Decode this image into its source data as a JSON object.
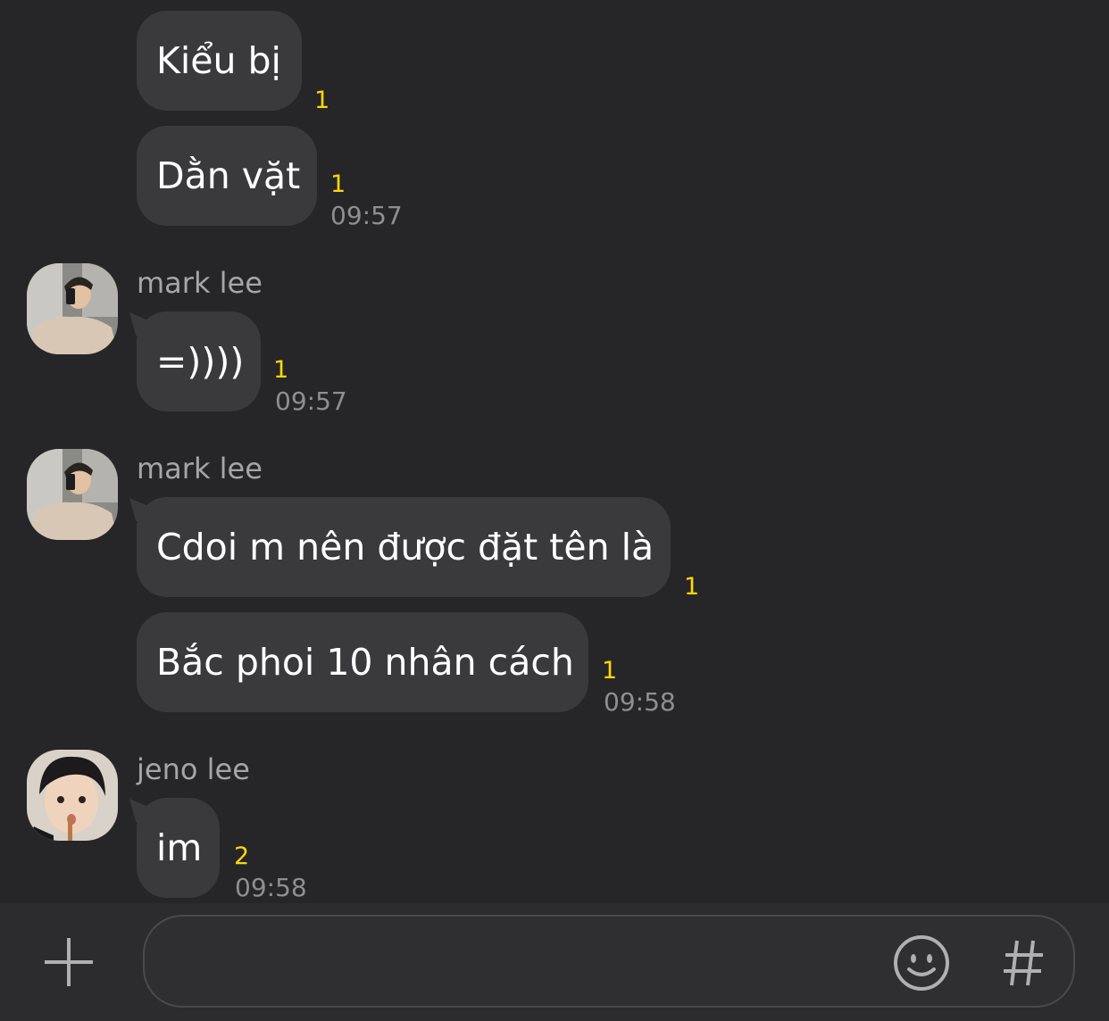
{
  "messages": [
    {
      "text": "Kiểu bị",
      "unread": "1",
      "time": ""
    },
    {
      "text": "Dằn vặt",
      "unread": "1",
      "time": "09:57"
    },
    {
      "sender": "mark lee",
      "text": "=))))",
      "unread": "1",
      "time": "09:57"
    },
    {
      "sender": "mark lee",
      "text": "Cdoi m nên được đặt tên là",
      "unread": "1",
      "time": ""
    },
    {
      "text": "Bắc phoi 10 nhân cách",
      "unread": "1",
      "time": "09:58"
    },
    {
      "sender": "jeno lee",
      "text": "im",
      "unread": "2",
      "time": "09:58"
    }
  ],
  "composer": {
    "add_icon": "plus-icon",
    "emoji_icon": "smiley-icon",
    "hashtag_icon": "hashtag-icon"
  },
  "colors": {
    "background": "#262628",
    "bubble": "#3a3a3c",
    "unread": "#ffd60a",
    "time": "#8e8e93"
  }
}
